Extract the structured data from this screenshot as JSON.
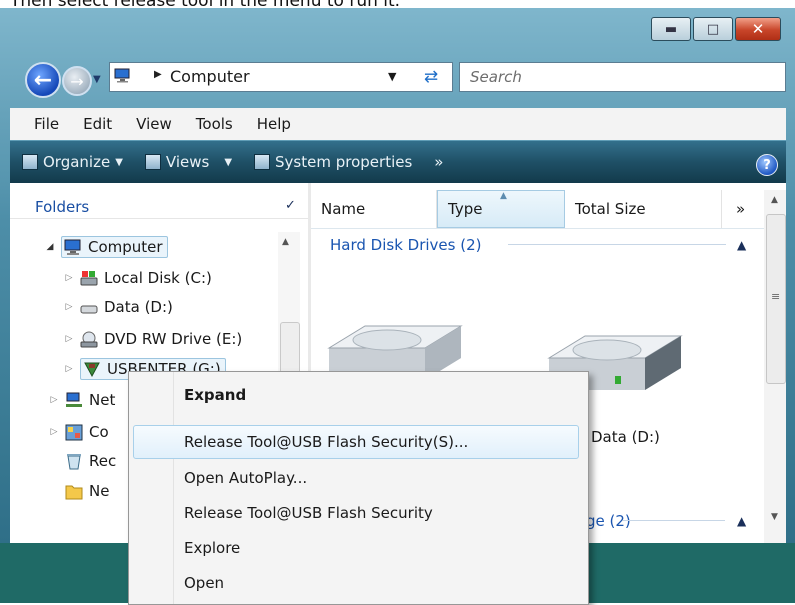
{
  "caption": "Then select release tool in the menu to run it.",
  "window": {
    "buttons": [
      {
        "name": "minimize",
        "icon": "minimize-icon"
      },
      {
        "name": "maximize",
        "icon": "maximize-icon"
      },
      {
        "name": "close",
        "icon": "close-icon"
      }
    ]
  },
  "nav": {
    "address": "Computer",
    "search_placeholder": "Search"
  },
  "menubar": [
    "File",
    "Edit",
    "View",
    "Tools",
    "Help"
  ],
  "commandbar": {
    "organize": "Organize",
    "views": "Views",
    "system_properties": "System properties",
    "more": "»"
  },
  "folders_pane": {
    "header": "Folders",
    "tree": [
      {
        "label": "Computer",
        "icon": "computer-icon",
        "expanded": true,
        "selected": true
      },
      {
        "label": "Local Disk (C:)",
        "icon": "local-disk-icon"
      },
      {
        "label": "Data (D:)",
        "icon": "hard-drive-icon"
      },
      {
        "label": "DVD RW Drive (E:)",
        "icon": "dvd-drive-icon"
      },
      {
        "label": "USBENTER (G:)",
        "icon": "usb-drive-icon",
        "selected": true
      },
      {
        "label": "Net",
        "icon": "network-icon"
      },
      {
        "label": "Co",
        "icon": "control-panel-icon"
      },
      {
        "label": "Rec",
        "icon": "recycle-bin-icon"
      },
      {
        "label": "Ne",
        "icon": "folder-icon"
      }
    ]
  },
  "columns": [
    "Name",
    "Type",
    "Total Size",
    "»"
  ],
  "groups": {
    "hard_disks": "Hard Disk Drives (2)",
    "drive_label": "Data (D:)",
    "removable": "ge (2)"
  },
  "context_menu": {
    "items": [
      {
        "label": "Expand",
        "bold": true
      },
      {
        "label": "Release Tool@USB Flash Security(S)...",
        "highlighted": true
      },
      {
        "label": "Open AutoPlay..."
      },
      {
        "label": "Release Tool@USB Flash Security"
      },
      {
        "label": "Explore"
      },
      {
        "label": "Open"
      }
    ]
  },
  "colors": {
    "accent_blue": "#1a55b0",
    "command_bar": "#1f5066",
    "desktop": "#1f6a66",
    "highlight": "#e1f0fb"
  }
}
